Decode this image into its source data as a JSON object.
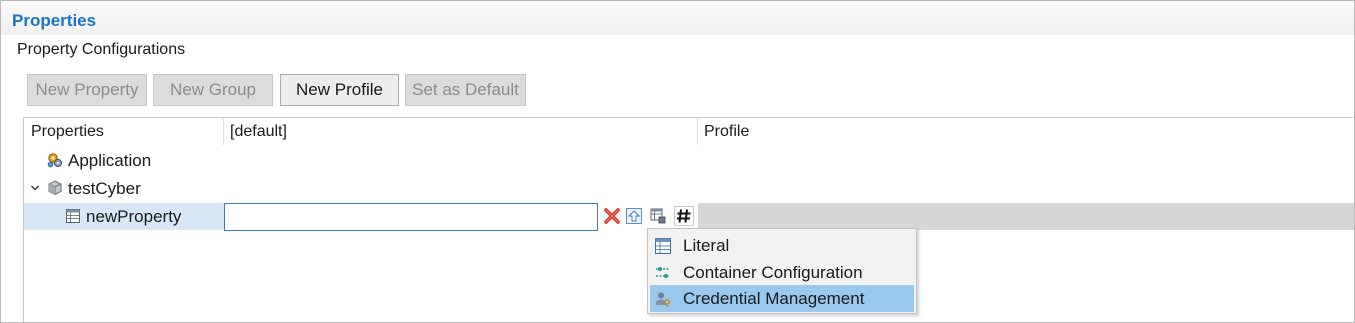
{
  "panel": {
    "title": "Properties",
    "subtitle": "Property Configurations"
  },
  "toolbar": {
    "new_property": "New Property",
    "new_group": "New Group",
    "new_profile": "New Profile",
    "set_default": "Set as Default"
  },
  "table": {
    "columns": [
      "Properties",
      "[default]",
      "Profile"
    ],
    "rows": {
      "application": "Application",
      "group": "testCyber",
      "property": "newProperty"
    },
    "value_input": ""
  },
  "menu": {
    "items": [
      "Literal",
      "Container Configuration",
      "Credential Management"
    ],
    "selected_index": 2
  },
  "colors": {
    "title": "#1a73c7",
    "selection": "#99c9ef",
    "row_selection": "#d7e7f7"
  }
}
